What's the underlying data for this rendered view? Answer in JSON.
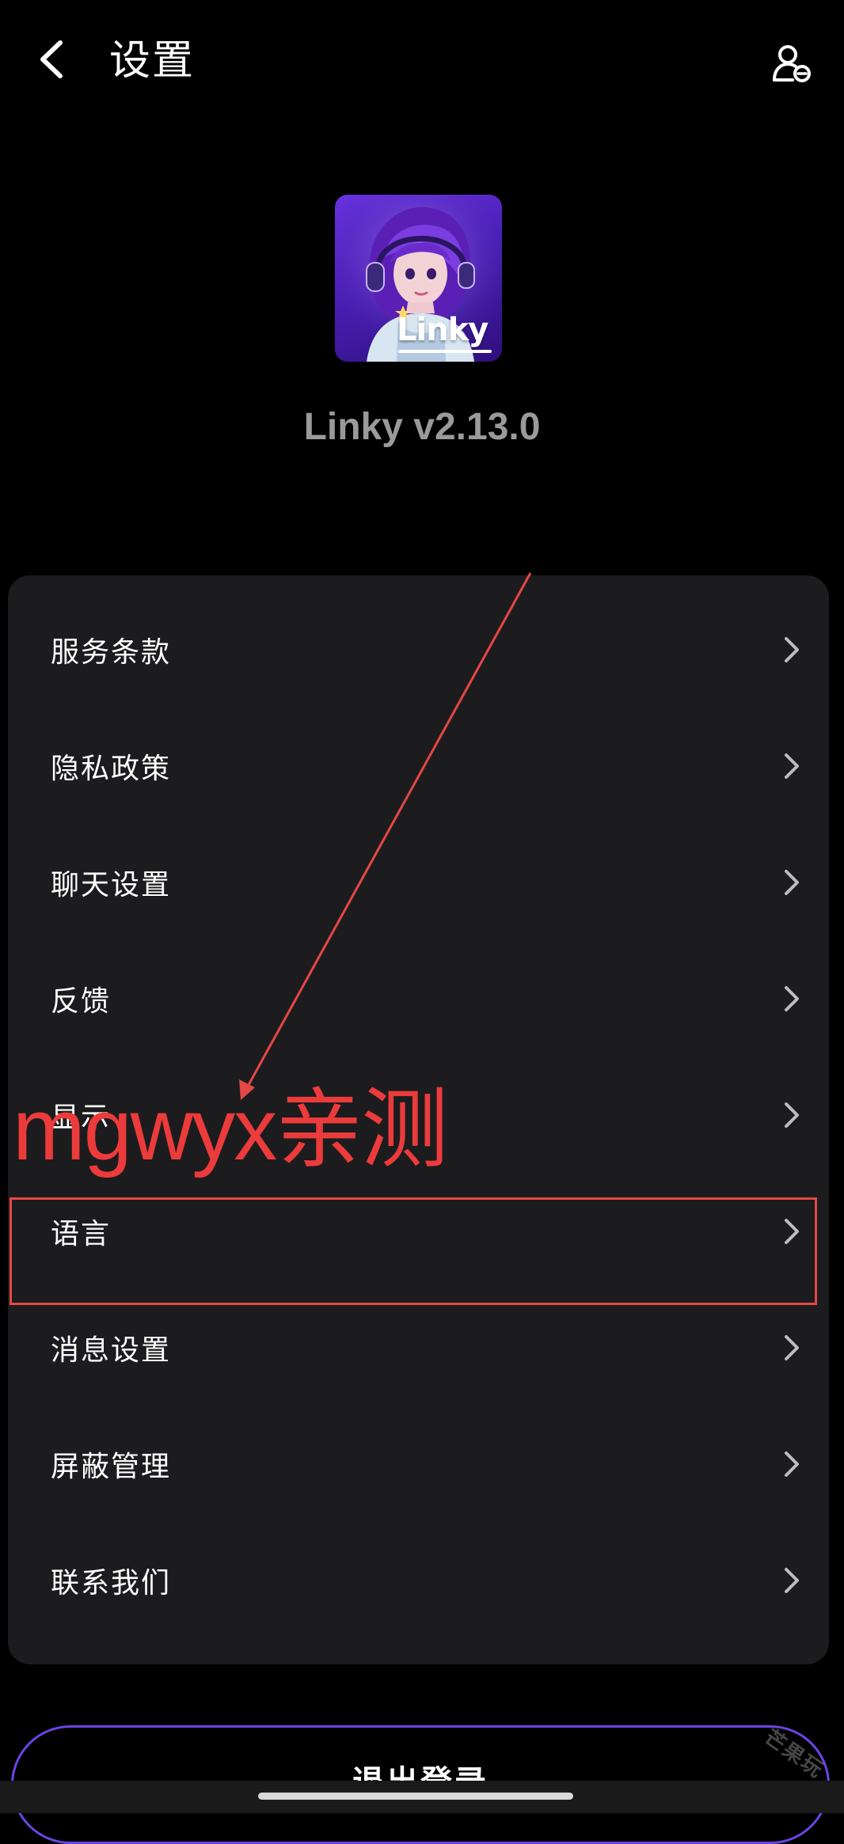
{
  "header": {
    "title": "设置",
    "back_icon": "chevron-left-icon",
    "account_icon": "user-minus-icon"
  },
  "app": {
    "logo_text": "Linky",
    "version": "Linky v2.13.0"
  },
  "settings": {
    "items": [
      {
        "label": "服务条款"
      },
      {
        "label": "隐私政策"
      },
      {
        "label": "聊天设置"
      },
      {
        "label": "反馈"
      },
      {
        "label": "显示"
      },
      {
        "label": "语言"
      },
      {
        "label": "消息设置"
      },
      {
        "label": "屏蔽管理"
      },
      {
        "label": "联系我们"
      }
    ]
  },
  "logout": {
    "label": "退出登录"
  },
  "annotation": {
    "text": "mgwyx亲测",
    "color": "#ec3b3b"
  },
  "watermark": {
    "text": "芒果玩"
  },
  "colors": {
    "background": "#000000",
    "card": "#1c1c1e",
    "accent": "#6a44e6",
    "version_text": "#9a9a9a"
  }
}
